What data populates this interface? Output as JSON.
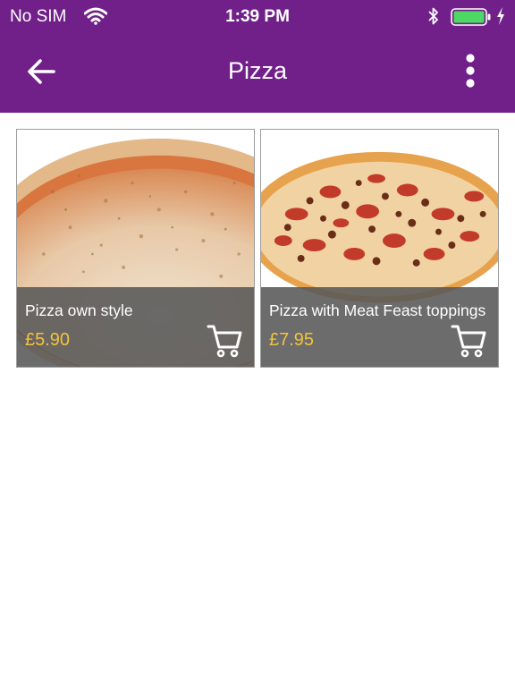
{
  "status_bar": {
    "carrier": "No SIM",
    "time": "1:39 PM",
    "battery_color": "#4cd964"
  },
  "header": {
    "title": "Pizza",
    "back_icon": "arrow-left-icon",
    "menu_icon": "more-vertical-icon",
    "background": "#71208a"
  },
  "products": [
    {
      "name": "Pizza own style",
      "price": "£5.90",
      "image": "margherita-pizza-image",
      "action_icon": "shopping-cart-icon"
    },
    {
      "name": "Pizza with Meat Feast toppings",
      "price": "£7.95",
      "image": "meat-feast-pizza-image",
      "action_icon": "shopping-cart-icon"
    }
  ],
  "price_color": "#f2c43b"
}
